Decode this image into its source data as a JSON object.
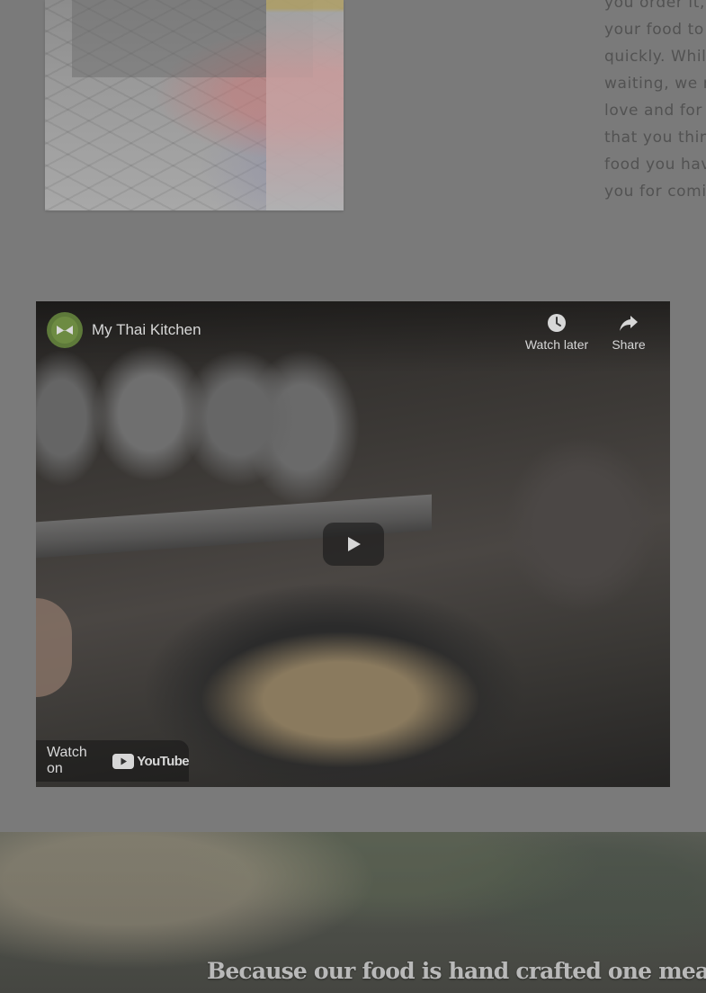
{
  "intro": {
    "lines": [
      "you order it, w",
      "your food to b",
      "quickly. While",
      "waiting, we ma",
      "love and for th",
      "that you think",
      "food you have",
      "you for comin"
    ]
  },
  "video": {
    "title": "My Thai Kitchen",
    "watch_later": "Watch later",
    "share": "Share",
    "watch_on": "Watch on",
    "youtube_word": "YouTube"
  },
  "banner": {
    "heading": "Because our food is hand crafted one meal"
  },
  "colors": {
    "overlay_gray": "#7a7a7a",
    "text_dim": "#525252",
    "video_text": "#d7d7d7"
  }
}
